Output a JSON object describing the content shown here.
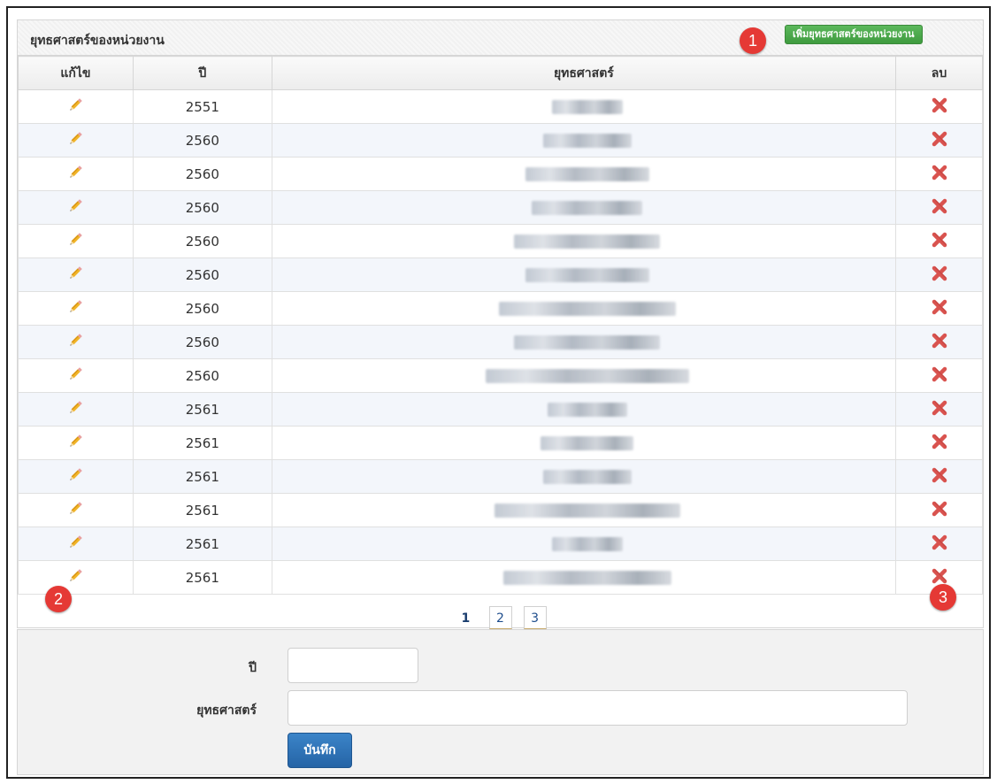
{
  "panel": {
    "title": "ยุทธศาสตร์ของหน่วยงาน",
    "add_button": "เพิ่มยุทธศาสตร์ของหน่วยงาน"
  },
  "markers": [
    "1",
    "2",
    "3"
  ],
  "table": {
    "headers": [
      "แก้ไข",
      "ปี",
      "ยุทธศาสตร์",
      "ลบ"
    ],
    "rows": [
      {
        "year": "2551"
      },
      {
        "year": "2560"
      },
      {
        "year": "2560"
      },
      {
        "year": "2560"
      },
      {
        "year": "2560"
      },
      {
        "year": "2560"
      },
      {
        "year": "2560"
      },
      {
        "year": "2560"
      },
      {
        "year": "2560"
      },
      {
        "year": "2561"
      },
      {
        "year": "2561"
      },
      {
        "year": "2561"
      },
      {
        "year": "2561"
      },
      {
        "year": "2561"
      },
      {
        "year": "2561"
      }
    ]
  },
  "pagination": {
    "pages": [
      "1",
      "2",
      "3"
    ],
    "current": "1"
  },
  "form": {
    "year_label": "ปี",
    "year_value": "",
    "strategy_label": "ยุทธศาสตร์",
    "strategy_value": "",
    "save_label": "บันทึก"
  },
  "icons": {
    "edit": "pencil-icon",
    "delete": "delete-x-icon"
  },
  "colors": {
    "add_button": "#4cae4c",
    "save_button": "#2f74b5",
    "marker": "#e53935",
    "delete": "#d9534f"
  }
}
